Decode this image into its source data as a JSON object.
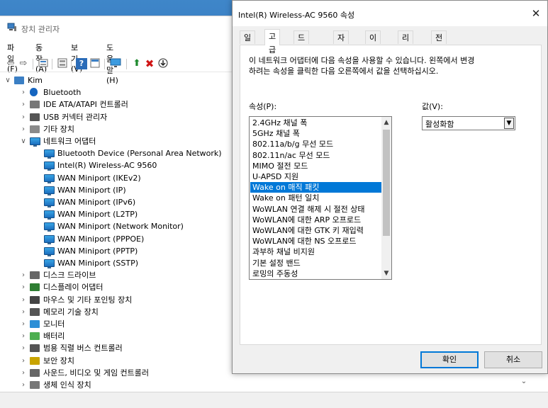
{
  "device_manager": {
    "title": "장치 관리자",
    "menu": [
      "파일(F)",
      "동작(A)",
      "보기(V)",
      "도움말(H)"
    ],
    "toolbar_icons": [
      "back-arrow-icon",
      "forward-arrow-icon",
      "properties-icon",
      "device-list-icon",
      "help-icon",
      "view-icon",
      "monitor-icon",
      "update-driver-icon",
      "uninstall-x-icon",
      "download-arrow-icon"
    ],
    "tree": [
      {
        "label": "Kim",
        "indent": 0,
        "expanded": true,
        "icon": "computer-icon"
      },
      {
        "label": "Bluetooth",
        "indent": 1,
        "expanded": false,
        "icon": "bluetooth-icon"
      },
      {
        "label": "IDE ATA/ATAPI 컨트롤러",
        "indent": 1,
        "expanded": false,
        "icon": "ide-controller-icon"
      },
      {
        "label": "USB 커넥터 관리자",
        "indent": 1,
        "expanded": false,
        "icon": "usb-icon"
      },
      {
        "label": "기타 장치",
        "indent": 1,
        "expanded": false,
        "icon": "other-device-icon"
      },
      {
        "label": "네트워크 어댑터",
        "indent": 1,
        "expanded": true,
        "icon": "network-adapter-icon"
      },
      {
        "label": "Bluetooth Device (Personal Area Network)",
        "indent": 2,
        "icon": "network-adapter-icon"
      },
      {
        "label": "Intel(R) Wireless-AC 9560",
        "indent": 2,
        "icon": "network-adapter-icon"
      },
      {
        "label": "WAN Miniport (IKEv2)",
        "indent": 2,
        "icon": "network-adapter-icon"
      },
      {
        "label": "WAN Miniport (IP)",
        "indent": 2,
        "icon": "network-adapter-icon"
      },
      {
        "label": "WAN Miniport (IPv6)",
        "indent": 2,
        "icon": "network-adapter-icon"
      },
      {
        "label": "WAN Miniport (L2TP)",
        "indent": 2,
        "icon": "network-adapter-icon"
      },
      {
        "label": "WAN Miniport (Network Monitor)",
        "indent": 2,
        "icon": "network-adapter-icon"
      },
      {
        "label": "WAN Miniport (PPPOE)",
        "indent": 2,
        "icon": "network-adapter-icon"
      },
      {
        "label": "WAN Miniport (PPTP)",
        "indent": 2,
        "icon": "network-adapter-icon"
      },
      {
        "label": "WAN Miniport (SSTP)",
        "indent": 2,
        "icon": "network-adapter-icon"
      },
      {
        "label": "디스크 드라이브",
        "indent": 1,
        "expanded": false,
        "icon": "disk-drive-icon"
      },
      {
        "label": "디스플레이 어댑터",
        "indent": 1,
        "expanded": false,
        "icon": "display-adapter-icon"
      },
      {
        "label": "마우스 및 기타 포인팅 장치",
        "indent": 1,
        "expanded": false,
        "icon": "mouse-icon"
      },
      {
        "label": "메모리 기술 장치",
        "indent": 1,
        "expanded": false,
        "icon": "memory-icon"
      },
      {
        "label": "모니터",
        "indent": 1,
        "expanded": false,
        "icon": "monitor-icon"
      },
      {
        "label": "배터리",
        "indent": 1,
        "expanded": false,
        "icon": "battery-icon"
      },
      {
        "label": "범용 직렬 버스 컨트롤러",
        "indent": 1,
        "expanded": false,
        "icon": "usb-icon"
      },
      {
        "label": "보안 장치",
        "indent": 1,
        "expanded": false,
        "icon": "security-device-icon"
      },
      {
        "label": "사운드, 비디오 및 게임 컨트롤러",
        "indent": 1,
        "expanded": false,
        "icon": "sound-icon"
      },
      {
        "label": "생체 인식 장치",
        "indent": 1,
        "expanded": false,
        "icon": "biometric-icon"
      }
    ]
  },
  "dialog": {
    "title": "Intel(R) Wireless-AC 9560 속성",
    "tabs": [
      "일반",
      "고급",
      "드라이버",
      "자세히",
      "이벤트",
      "리소스",
      "전원 관리"
    ],
    "active_tab": 1,
    "description_line1": "이 네트워크 어댑터에 다음 속성을 사용할 수 있습니다. 왼쪽에서 변경",
    "description_line2": "하려는 속성을 클릭한 다음 오른쪽에서 값을 선택하십시오.",
    "property_label": "속성(P):",
    "value_label": "값(V):",
    "properties": [
      "2.4GHz 채널 폭",
      "5GHz 채널 폭",
      "802.11a/b/g 무선 모드",
      "802.11n/ac 무선 모드",
      "MIMO 절전 모드",
      "U-APSD 지원",
      "Wake on 매직 패킷",
      "Wake on 패턴 일치",
      "WoWLAN 연결 해제 시 절전 상태",
      "WoWLAN에 대한 ARP 오프로드",
      "WoWLAN에 대한 GTK 키 재입력",
      "WoWLAN에 대한 NS 오프로드",
      "과부하 채널 비지원",
      "기본 설정 밴드",
      "로밍의 주동성"
    ],
    "selected_property": 6,
    "value": "활성화함",
    "ok_label": "확인",
    "cancel_label": "취소",
    "accent_color": "#0078d7"
  }
}
